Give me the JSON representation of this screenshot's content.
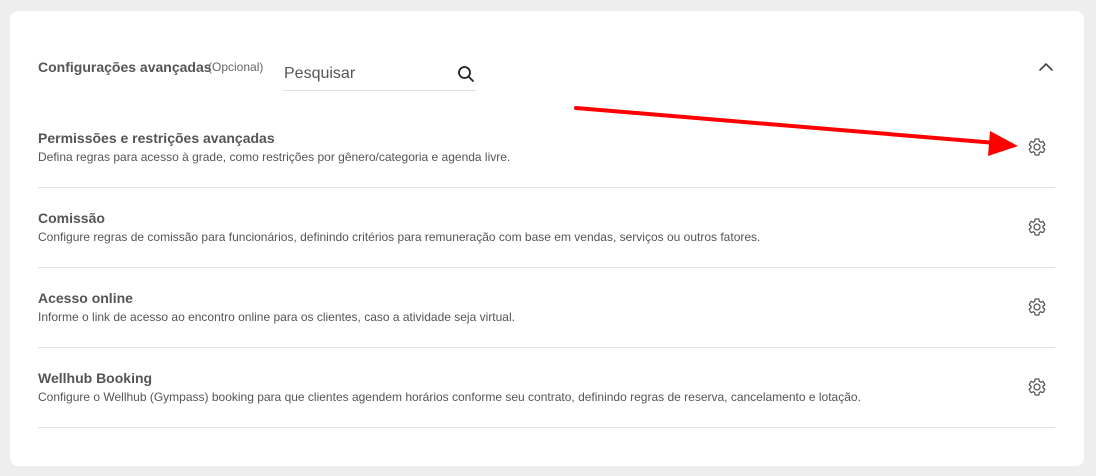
{
  "section": {
    "title": "Configurações avançadas",
    "optional_label": "(Opcional)",
    "search_placeholder": "Pesquisar"
  },
  "rows": [
    {
      "title": "Permissões e restrições avançadas",
      "description": "Defina regras para acesso à grade, como restrições por gênero/categoria e agenda livre."
    },
    {
      "title": "Comissão",
      "description": "Configure regras de comissão para funcionários, definindo critérios para remuneração com base em vendas, serviços ou outros fatores."
    },
    {
      "title": "Acesso online",
      "description": "Informe o link de acesso ao encontro online para os clientes, caso a atividade seja virtual."
    },
    {
      "title": "Wellhub Booking",
      "description": "Configure o Wellhub (Gympass) booking para que clientes agendem horários conforme seu contrato, definindo regras de reserva, cancelamento e lotação."
    }
  ],
  "icons": {
    "search": "search-icon",
    "collapse": "chevron-up-icon",
    "settings": "gear-icon"
  },
  "colors": {
    "annotation_arrow": "#ff0000",
    "text": "#555555",
    "divider": "#e3e3e3",
    "background": "#eeeeee",
    "card": "#ffffff"
  }
}
